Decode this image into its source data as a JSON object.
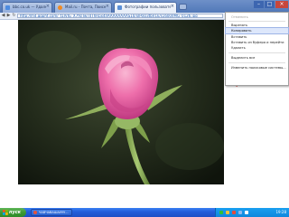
{
  "browser": {
    "tabs": [
      {
        "title": "bbc.co.uk — Удалено",
        "active": false,
        "favicon_color": "#4c8be0"
      },
      {
        "title": "Mail.ru - Почта, Поиск в",
        "active": false,
        "favicon_color": "#f08a24"
      },
      {
        "title": "Фотографии пользователя",
        "active": true,
        "favicon_color": "#5b8fd6"
      }
    ],
    "omnibox": {
      "url": "http://lh4.ggpht.com/_t1JVJG_X7fk/TwT0ThRpx4I/AAAAAAAAS10/xJPoQ3tbV1k/s1600/IMG_0126.jpg"
    },
    "window_controls": {
      "minimize": "–",
      "maximize": "□",
      "close": "×"
    },
    "nav_icons": [
      "back-icon",
      "forward-icon",
      "reload-icon"
    ]
  },
  "context_menu": {
    "items": [
      {
        "label": "Отменить",
        "state": "disabled"
      },
      {
        "separator": true
      },
      {
        "label": "Вырезать",
        "state": "enabled"
      },
      {
        "label": "Копировать",
        "state": "highlight"
      },
      {
        "label": "Вставить",
        "state": "enabled"
      },
      {
        "label": "Вставить из буфера и перейти",
        "state": "enabled"
      },
      {
        "label": "Удалить",
        "state": "enabled"
      },
      {
        "separator": true
      },
      {
        "label": "Выделить все",
        "state": "enabled"
      },
      {
        "separator": true
      },
      {
        "label": "Изменить поисковые системы...",
        "state": "enabled"
      }
    ]
  },
  "taskbar": {
    "start_label": "пуск",
    "items": [
      {
        "label": "ЧАВЧАВАШАУУУ...",
        "icon_color": "#e5533b"
      }
    ],
    "clock": "19:28",
    "tray_icon_colors": [
      "#2fbf3a",
      "#f0c23a",
      "#e24b3b",
      "#8fb8ef",
      "#ffffff"
    ]
  },
  "colors": {
    "highlight_stroke": "#e0443a",
    "petal_light": "#f7a1c6",
    "petal_main": "#ea5fa0",
    "petal_dark": "#c23a7e",
    "stem": "#8fb35a"
  }
}
